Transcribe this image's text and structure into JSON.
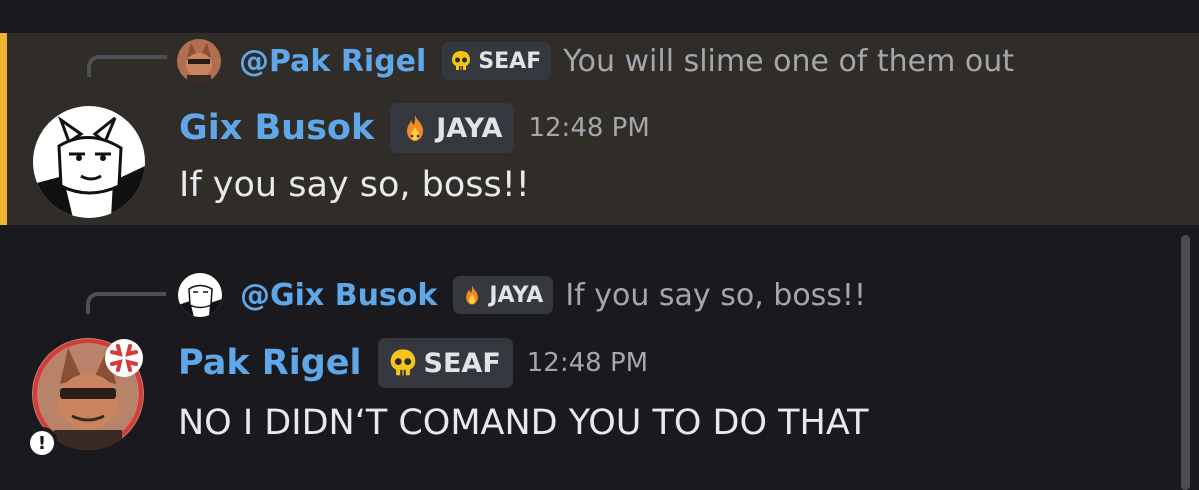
{
  "messages": [
    {
      "reply": {
        "mention": "@Pak Rigel",
        "tag": "SEAF",
        "text": "You will slime one of them out"
      },
      "author": "Gix Busok",
      "tag": "JAYA",
      "time": "12:48 PM",
      "content": "If you say so, boss!!"
    },
    {
      "reply": {
        "mention": "@Gix Busok",
        "tag": "JAYA",
        "text": "If you say so, boss!!"
      },
      "author": "Pak Rigel",
      "tag": "SEAF",
      "time": "12:48 PM",
      "content": "NO I DIDN‘T COMAND YOU TO DO THAT"
    }
  ],
  "colors": {
    "background": "#1a1a1e",
    "highlight_background": "#302c27",
    "highlight_bar": "#f0b232",
    "username": "#5fa7e8",
    "muted_text": "#a4a6ae",
    "tag_background": "#36383f"
  },
  "icons": {
    "seaf_tag": "skull-icon",
    "jaya_tag": "flame-icon",
    "status": "exclamation-icon",
    "reaction": "anger-icon"
  }
}
